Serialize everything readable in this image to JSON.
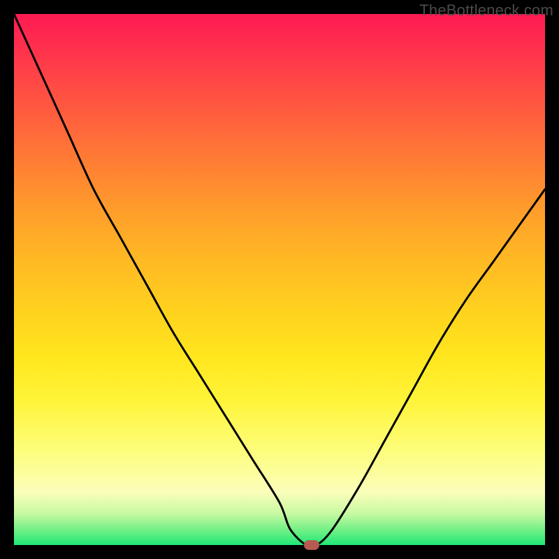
{
  "watermark": {
    "text": "TheBottleneck.com"
  },
  "chart_data": {
    "type": "line",
    "title": "",
    "xlabel": "",
    "ylabel": "",
    "x": [
      0,
      5,
      10,
      15,
      20,
      25,
      30,
      35,
      40,
      45,
      50,
      52,
      55,
      57,
      60,
      65,
      70,
      75,
      80,
      85,
      90,
      95,
      100
    ],
    "values": [
      100,
      89,
      78,
      67,
      58,
      49,
      40,
      32,
      24,
      16,
      8,
      3,
      0,
      0,
      3,
      11,
      20,
      29,
      38,
      46,
      53,
      60,
      67
    ],
    "xlim": [
      0,
      100
    ],
    "ylim": [
      0,
      100
    ],
    "marker": {
      "x": 56,
      "y": 0
    }
  },
  "colors": {
    "background": "#000000",
    "curve": "#000000",
    "marker": "#b65a52",
    "watermark": "#4b4b4b"
  }
}
